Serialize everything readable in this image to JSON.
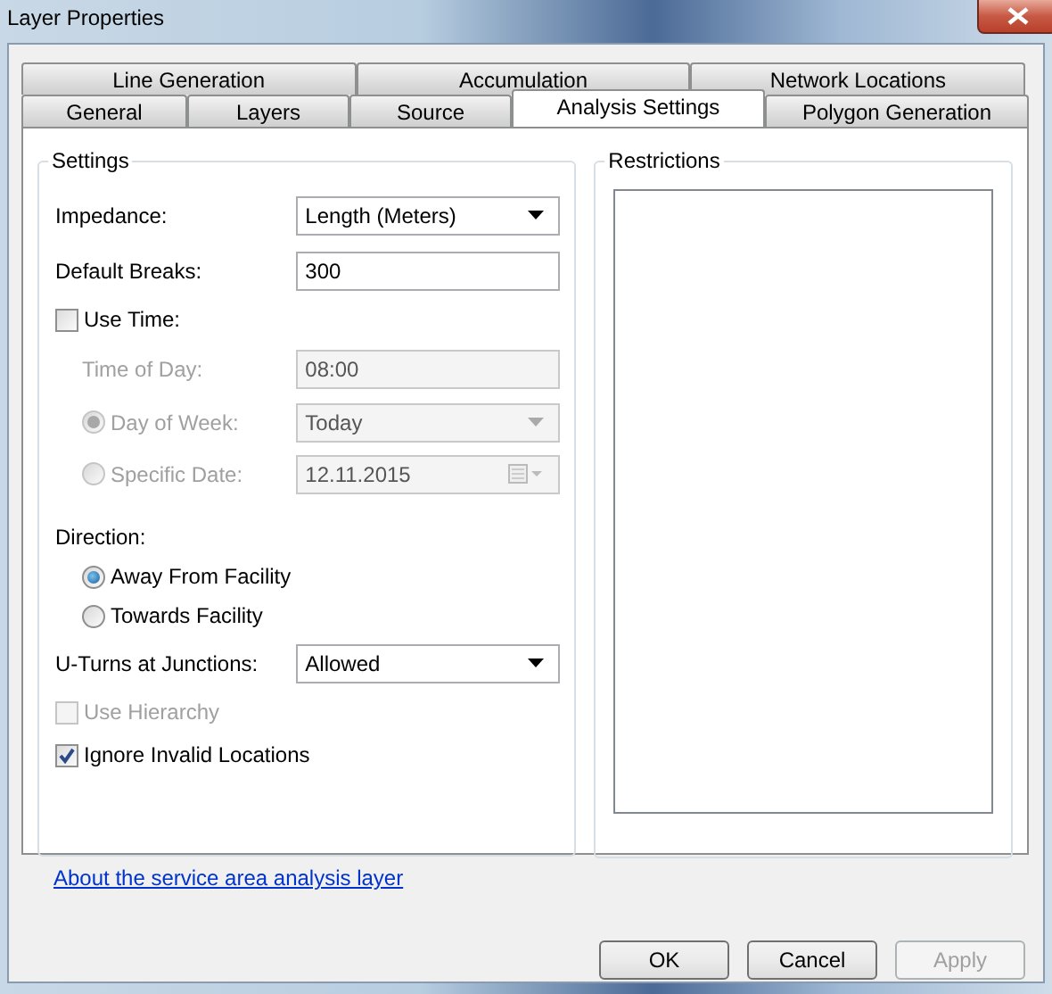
{
  "window": {
    "title": "Layer Properties"
  },
  "tabs": [
    [
      {
        "label": "Line Generation",
        "selected": false
      },
      {
        "label": "Accumulation",
        "selected": false
      },
      {
        "label": "Network Locations",
        "selected": false
      }
    ],
    [
      {
        "label": "General",
        "selected": false
      },
      {
        "label": "Layers",
        "selected": false
      },
      {
        "label": "Source",
        "selected": false
      },
      {
        "label": "Analysis Settings",
        "selected": true
      },
      {
        "label": "Polygon Generation",
        "selected": false
      }
    ]
  ],
  "settings": {
    "title": "Settings",
    "items": [
      {
        "kind": "dropdown",
        "label": "Impedance:",
        "value": "Length (Meters)",
        "disabled": false
      },
      {
        "kind": "text",
        "label": "Default Breaks:",
        "value": "300",
        "disabled": false
      },
      {
        "kind": "checkbox",
        "label": "Use Time:",
        "checked": false,
        "disabled": false,
        "children": [
          {
            "kind": "text",
            "label": "Time of Day:",
            "value": "08:00",
            "disabled": true
          },
          {
            "kind": "radio-dropdown",
            "label": "Day of Week:",
            "selected": true,
            "value": "Today",
            "disabled": true
          },
          {
            "kind": "radio-date",
            "label": "Specific Date:",
            "selected": false,
            "value": "12.11.2015",
            "disabled": true
          }
        ]
      },
      {
        "kind": "heading",
        "label": "Direction:",
        "children": [
          {
            "kind": "radio",
            "label": "Away From Facility",
            "selected": true,
            "disabled": false
          },
          {
            "kind": "radio",
            "label": "Towards Facility",
            "selected": false,
            "disabled": false
          }
        ]
      },
      {
        "kind": "dropdown",
        "label": "U-Turns at Junctions:",
        "value": "Allowed",
        "disabled": false
      },
      {
        "kind": "checkbox",
        "label": "Use Hierarchy",
        "checked": false,
        "disabled": true
      },
      {
        "kind": "checkbox",
        "label": "Ignore Invalid Locations",
        "checked": true,
        "disabled": false
      }
    ]
  },
  "restrictions": {
    "title": "Restrictions"
  },
  "link": "About the service area analysis layer",
  "buttons": [
    {
      "label": "OK",
      "disabled": false
    },
    {
      "label": "Cancel",
      "disabled": false
    },
    {
      "label": "Apply",
      "disabled": true
    }
  ]
}
